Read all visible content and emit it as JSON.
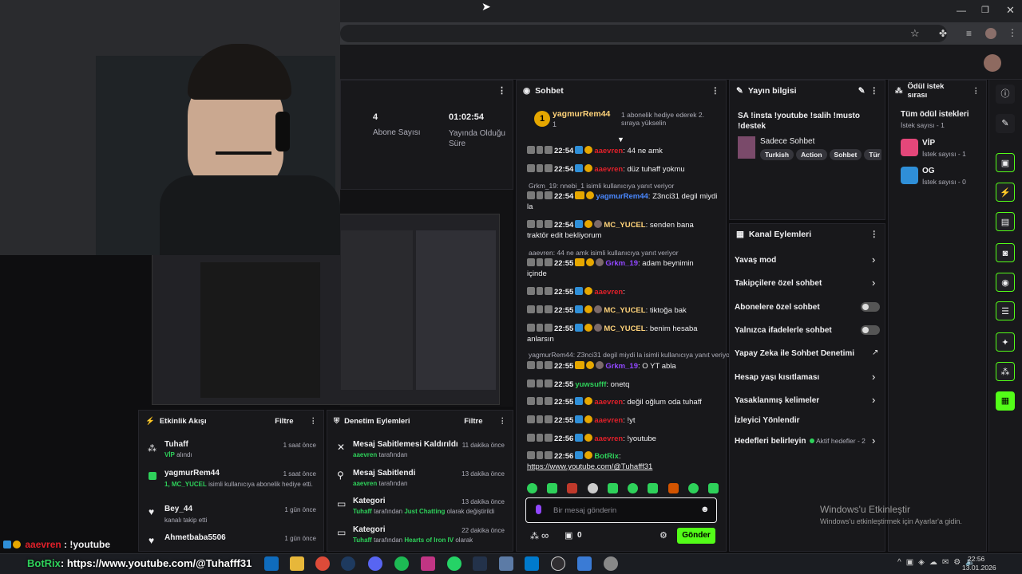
{
  "colors": {
    "accent": "#53fc18",
    "bg": "#0e0e10",
    "panel": "#18181b",
    "red_user": "#e0202a",
    "purple_user": "#9147ff",
    "blue_user": "#4a88ff"
  },
  "stats": {
    "subs_count": "4",
    "subs_label": "Abone Sayısı",
    "uptime": "01:02:54",
    "uptime_label": "Yayında Olduğu Süre"
  },
  "chat": {
    "title": "Sohbet",
    "pinned_user": "yagmurRem44",
    "pinned_count": "1",
    "pinned_note": "1 abonelik hediye ederek 2. sıraya yükselin",
    "messages": [
      {
        "time": "22:54",
        "user": "aaevren",
        "text": ": 44 ne amk"
      },
      {
        "time": "22:54",
        "user": "aaevren",
        "text": ": düz tuhaff yokmu"
      },
      {
        "reply": "Grkm_19: nnebi_1 isimli kullanıcıya yanıt veriyor"
      },
      {
        "time": "22:54",
        "user": "yagmurRem44",
        "text": ": Z3nci31 degil miydi",
        "cont": "la"
      },
      {
        "time": "22:54",
        "user": "MC_YUCEL",
        "text": ": senden bana",
        "cont": "traktör edit bekliyorum"
      },
      {
        "reply": "aaevren: 44 ne amk isimli kullanıcıya yanıt veriyor"
      },
      {
        "time": "22:55",
        "user": "Grkm_19",
        "text": ": adam beynimin",
        "cont": "içinde"
      },
      {
        "time": "22:55",
        "user": "aaevren",
        "text": ":"
      },
      {
        "time": "22:55",
        "user": "MC_YUCEL",
        "text": ": tiktoğa bak"
      },
      {
        "time": "22:55",
        "user": "MC_YUCEL",
        "text": ": benim hesaba",
        "cont": "anlarsın"
      },
      {
        "reply": "yagmurRem44: Z3nci31 degil miydi la isimli kullanıcıya yanıt veriyor"
      },
      {
        "time": "22:55",
        "user": "Grkm_19",
        "text": ": O YT abla"
      },
      {
        "time": "22:55",
        "user": "yuwsufff",
        "text": ": onetq"
      },
      {
        "time": "22:55",
        "user": "aaevren",
        "text": ": değil oğlum oda tuhaff"
      },
      {
        "time": "22:55",
        "user": "aaevren",
        "text": ": !yt"
      },
      {
        "time": "22:56",
        "user": "aaevren",
        "text": ": !youtube"
      },
      {
        "time": "22:56",
        "user": "BotRix",
        "text": ":",
        "cont": "https://www.youtube.com/@Tuhafff31"
      }
    ],
    "input_placeholder": "Bir mesaj gönderin",
    "infinite": "∞",
    "gift_count": "0",
    "send_label": "Gönder"
  },
  "stream_info": {
    "title": "Yayın bilgisi",
    "stream_title": "SA !insta !youtube !salih !musto !destek",
    "category": "Sadece Sohbet",
    "tags": [
      "Turkish",
      "Action",
      "Sohbet",
      "Tür"
    ]
  },
  "channel_actions": {
    "title": "Kanal Eylemleri",
    "items": [
      "Yavaş mod",
      "Takipçilere özel sohbet",
      "Abonelere özel sohbet",
      "Yalnızca ifadelerle sohbet",
      "Yapay Zeka ile Sohbet Denetimi",
      "Hesap yaşı kısıtlaması",
      "Yasaklanmış kelimeler",
      "İzleyici Yönlendir",
      "Hedefleri belirleyin"
    ],
    "goals_status": "Aktif hedefler - 2"
  },
  "rewards": {
    "title": "Ödül istek sırası",
    "all_label": "Tüm ödül istekleri",
    "all_count": "İstek sayısı - 1",
    "items": [
      {
        "name": "VİP",
        "count": "İstek sayısı - 1"
      },
      {
        "name": "OG",
        "count": "İstek sayısı - 0"
      }
    ]
  },
  "activity": {
    "title": "Etkinlik Akışı",
    "filter": "Filtre",
    "items": [
      {
        "name": "Tuhaff",
        "time": "1 saat önce",
        "sub_green": "VİP",
        "sub": " alındı"
      },
      {
        "name": "yagmurRem44",
        "time": "1 saat önce",
        "sub_green": "1, MC_YUCEL",
        "sub": " isimli kullanıcıya abonelik hediye",
        "sub2": "etti."
      },
      {
        "name": "Bey_44",
        "time": "1 gün önce",
        "sub": "kanalı takip etti"
      },
      {
        "name": "Ahmetbaba5506",
        "time": "1 gün önce",
        "sub": ""
      }
    ]
  },
  "moderation": {
    "title": "Denetim Eylemleri",
    "filter": "Filtre",
    "items": [
      {
        "name": "Mesaj Sabitlemesi Kaldırıldı",
        "time": "11 dakika önce",
        "who": "aaevren",
        "sub": " tarafından"
      },
      {
        "name": "Mesaj Sabitlendi",
        "time": "13 dakika önce",
        "who": "aaevren",
        "sub": " tarafından"
      },
      {
        "name": "Kategori",
        "time": "13 dakika önce",
        "who": "Tuhaff",
        "sub": " tarafından ",
        "green2": "Just Chatting",
        "sub2": " olarak değiştirildi"
      },
      {
        "name": "Kategori",
        "time": "22 dakika önce",
        "who": "Tuhaff",
        "sub": " tarafından ",
        "green2": "Hearts of Iron IV",
        "sub2": " olarak"
      }
    ]
  },
  "overlay": {
    "user": "aaevren",
    "text": " : !youtube",
    "bot": "BotRix",
    "link": ": https://www.youtube.com/@Tuhafff31"
  },
  "windows": {
    "activate_title": "Windows'u Etkinleştir",
    "activate_sub": "Windows'u etkinleştirmek için Ayarlar'a gidin."
  },
  "taskbar": {
    "time": "22:56",
    "date": "13.01.2026"
  },
  "icons": [
    "pin-icon",
    "timeout-icon",
    "shield-icon",
    "kebab-icon",
    "pencil-icon",
    "info-icon",
    "gift-icon",
    "settings-icon",
    "emoji-icon",
    "mic-icon"
  ]
}
